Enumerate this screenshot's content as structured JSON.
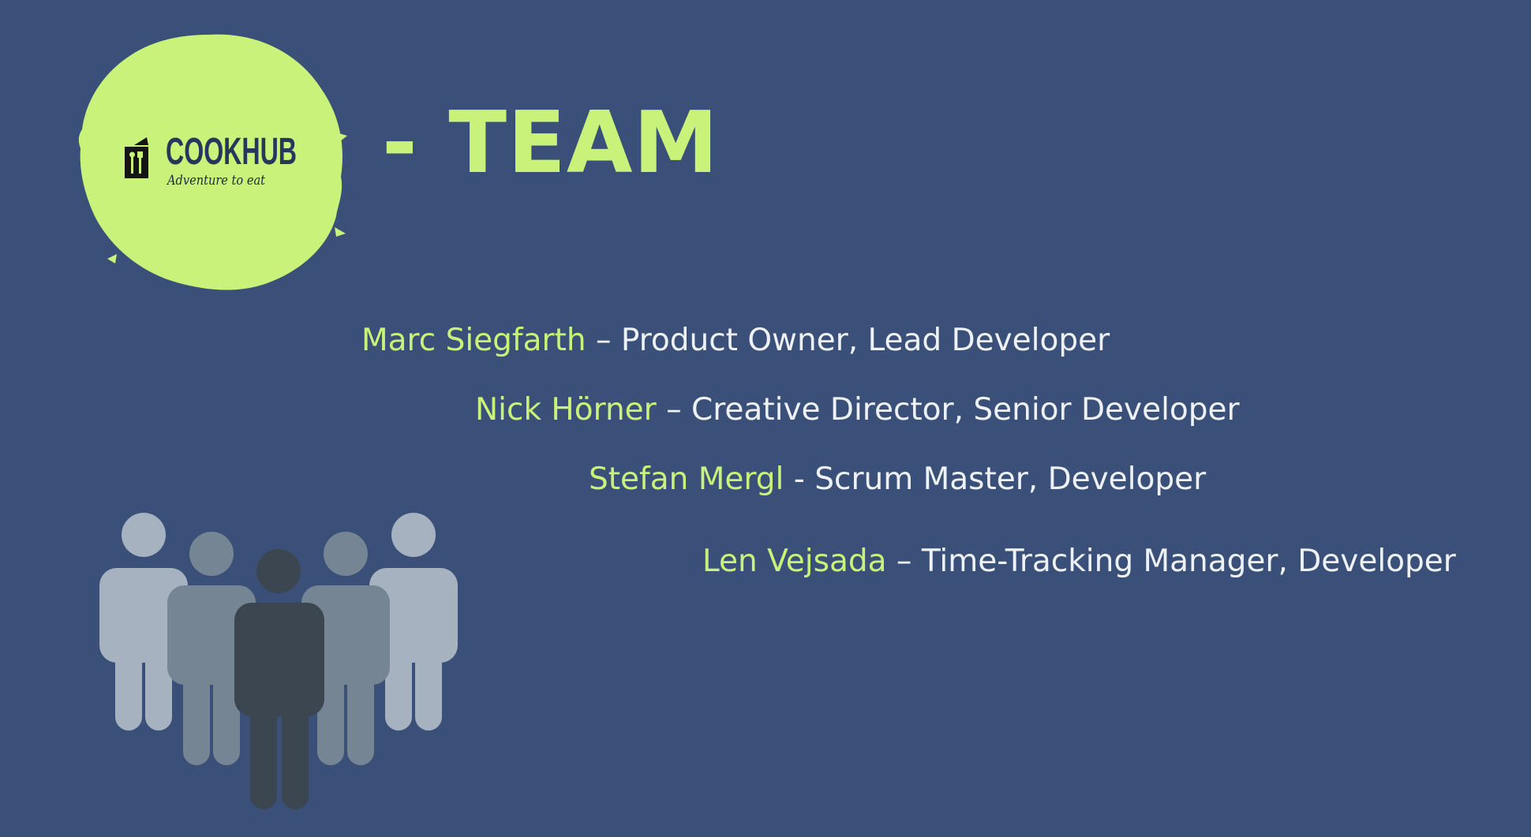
{
  "slide": {
    "background_color": "#3a5079",
    "accent_color": "#c8f27a",
    "text_color": "#eef2f6"
  },
  "logo": {
    "name": "COOKHUB",
    "tagline": "Adventure to eat",
    "icon": "restaurant-book-icon",
    "circle_color": "#c8f27a",
    "text_color": "#25375c"
  },
  "title": "- TEAM",
  "members": [
    {
      "name": "Marc Siegfarth",
      "separator": " – ",
      "role": "Product Owner, Lead Developer"
    },
    {
      "name": "Nick Hörner",
      "separator": " – ",
      "role": "Creative Director, Senior Developer"
    },
    {
      "name": "Stefan Mergl",
      "separator": " - ",
      "role": "Scrum Master, Developer"
    },
    {
      "name": "Len Vejsada",
      "separator": " – ",
      "role": "Time-Tracking Manager, Developer"
    }
  ],
  "illustration": {
    "icon": "team-people-icon",
    "colors": {
      "outer": "#a6b2c0",
      "middle": "#768593",
      "center": "#3c4650"
    }
  }
}
